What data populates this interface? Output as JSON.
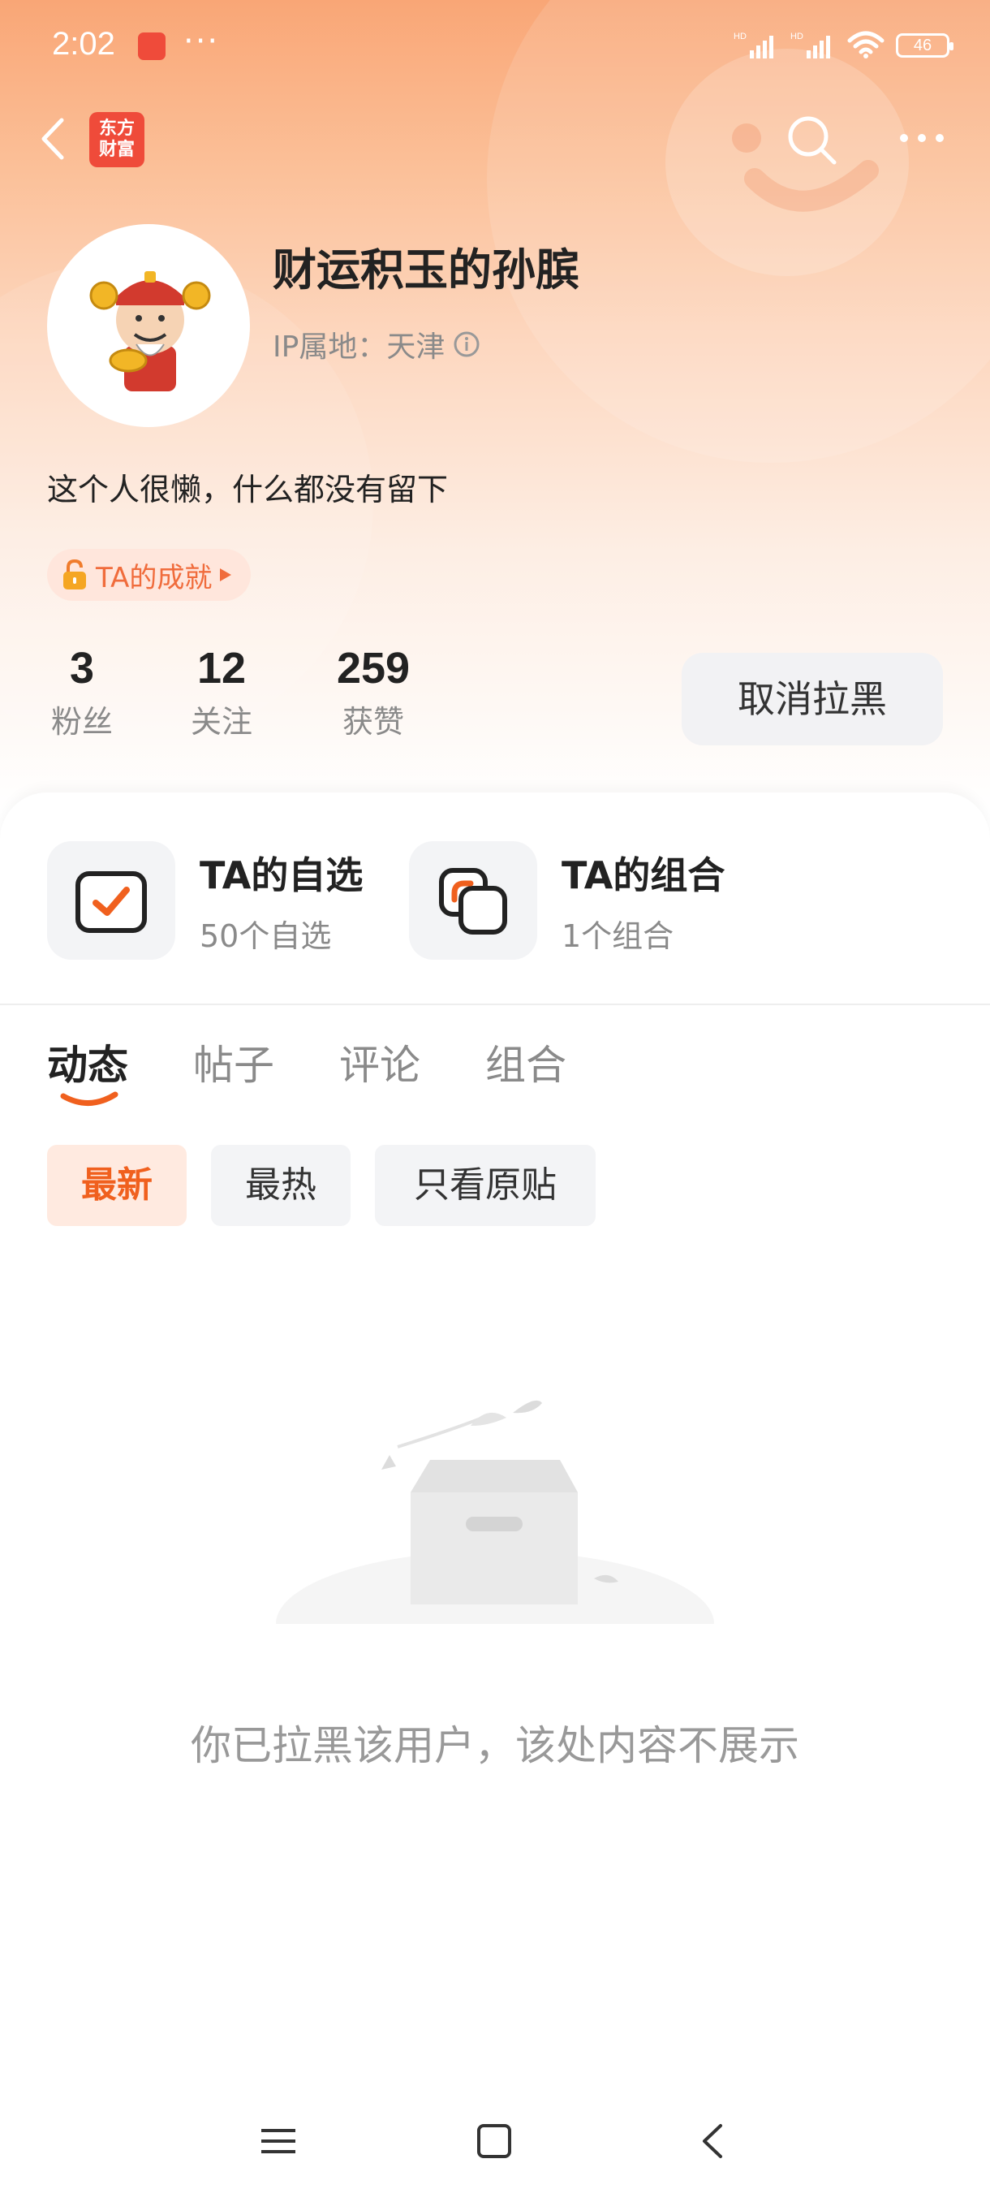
{
  "status_bar": {
    "time": "2:02",
    "dots": "···",
    "signal1": "HD",
    "signal2": "HD",
    "battery": "46"
  },
  "nav": {
    "brand_logo": "东方\n财富",
    "brand_line1": "东方",
    "brand_line2": "财富"
  },
  "profile": {
    "name": "财运积玉的孙膑",
    "ip": "IP属地：天津",
    "bio": "这个人很懒，什么都没有留下",
    "achievement": "TA的成就"
  },
  "stats": [
    {
      "value": "3",
      "label": "粉丝"
    },
    {
      "value": "12",
      "label": "关注"
    },
    {
      "value": "259",
      "label": "获赞"
    }
  ],
  "unblock_label": "取消拉黑",
  "quick": [
    {
      "title": "TA的自选",
      "sub": "50个自选"
    },
    {
      "title": "TA的组合",
      "sub": "1个组合"
    }
  ],
  "tabs": [
    "动态",
    "帖子",
    "评论",
    "组合"
  ],
  "filters": [
    "最新",
    "最热",
    "只看原贴"
  ],
  "empty_message": "你已拉黑该用户，该处内容不展示",
  "colors": {
    "accent": "#f0601e",
    "brand": "#ef4b3a"
  },
  "icons": [
    "back-icon",
    "search-icon",
    "more-icon",
    "info-icon",
    "lock-icon",
    "checkbox-icon",
    "portfolio-icon",
    "menu-icon",
    "home-icon",
    "back-nav-icon"
  ]
}
